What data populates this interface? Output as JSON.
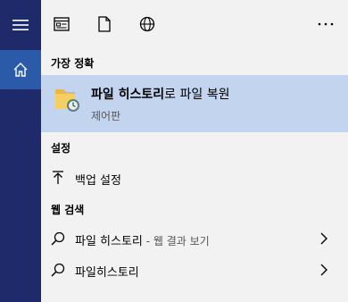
{
  "sections": {
    "best_match": "가장 정확",
    "settings": "설정",
    "web_search": "웹 검색"
  },
  "best_result": {
    "title_bold": "파일 히스토리",
    "title_rest": "로 파일 복원",
    "subtitle": "제어판"
  },
  "settings_item": {
    "label": "백업 설정"
  },
  "web_items": [
    {
      "label": "파일 히스토리",
      "suffix": " - 웹 결과 보기"
    },
    {
      "label": "파일히스토리",
      "suffix": ""
    }
  ],
  "colors": {
    "rail": "#1f2a6b",
    "rail_active": "#2b5aa8",
    "selected": "#c3d5ee",
    "panel": "#f2f2f2"
  },
  "icons": [
    "hamburger-icon",
    "home-icon",
    "apps-icon",
    "document-icon",
    "globe-icon",
    "more-icon",
    "folder-history-icon",
    "upload-icon",
    "search-icon",
    "chevron-right-icon"
  ]
}
